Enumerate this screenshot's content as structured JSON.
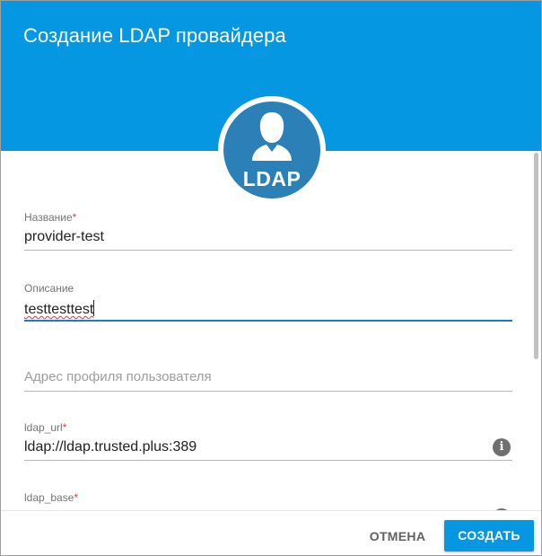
{
  "dialog": {
    "title": "Создание LDAP провайдера",
    "avatar_text": "LDAP"
  },
  "fields": {
    "name": {
      "label": "Название",
      "required_mark": "*",
      "value": "provider-test"
    },
    "description": {
      "label": "Описание",
      "value": "testtesttest"
    },
    "profile_url": {
      "placeholder": "Адрес профиля пользователя"
    },
    "ldap_url": {
      "label": "ldap_url",
      "required_mark": "*",
      "value": "ldap://ldap.trusted.plus:389"
    },
    "ldap_base": {
      "label": "ldap_base",
      "required_mark": "*"
    }
  },
  "footer": {
    "cancel_label": "ОТМЕНА",
    "create_label": "СОЗДАТЬ"
  },
  "colors": {
    "header": "#0597e2",
    "avatar": "#2c80b8",
    "focus_underline": "#1780c4",
    "required": "#e53935"
  },
  "icons": [
    "user-silhouette-icon",
    "info-icon"
  ]
}
